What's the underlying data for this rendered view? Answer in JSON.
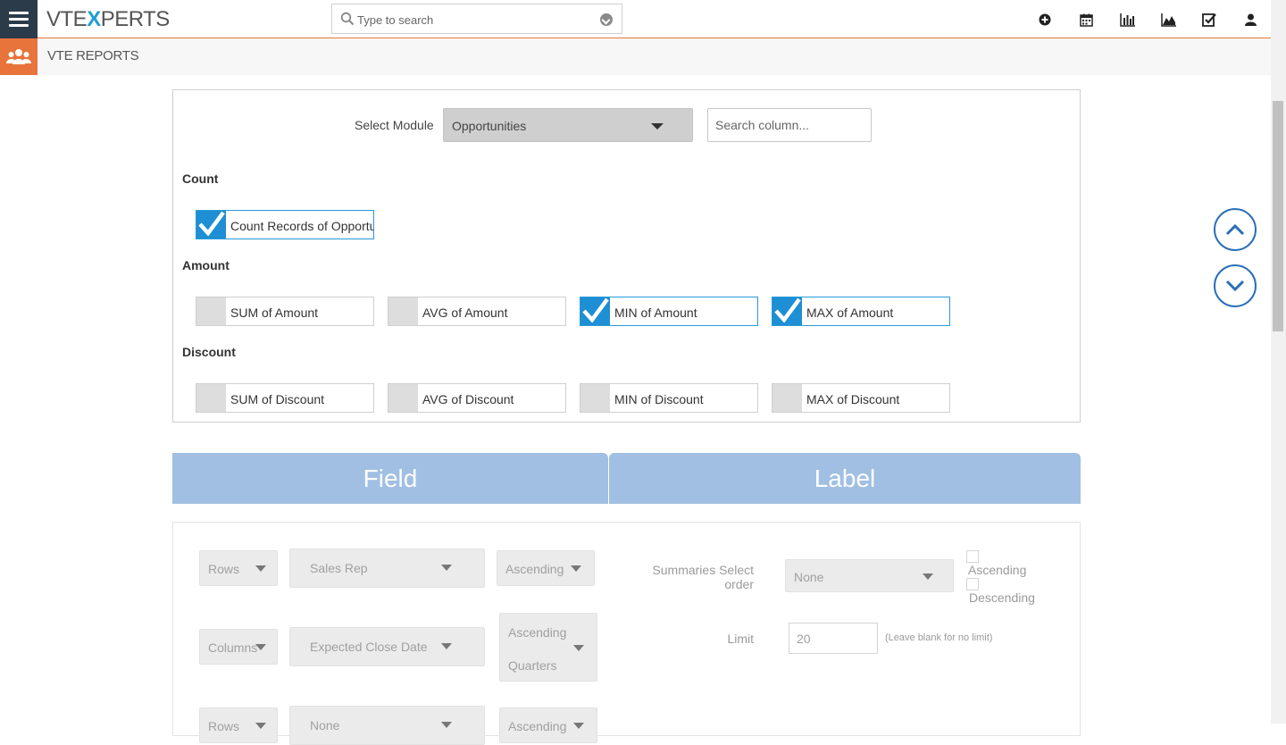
{
  "navbar": {
    "logo_pre": "VTE",
    "logo_x": "X",
    "logo_post": "PERTS",
    "search_placeholder": "Type to search",
    "icons": [
      "plus-circle-icon",
      "calendar-icon",
      "bar-chart-icon",
      "area-chart-icon",
      "checkbox-icon",
      "user-icon"
    ]
  },
  "module": {
    "title": "VTE REPORTS",
    "icon": "users-icon",
    "accent": "#e8743b"
  },
  "selector": {
    "label": "Select Module",
    "module_value": "Opportunities",
    "column_search_placeholder": "Search column..."
  },
  "groups": {
    "count": {
      "title": "Count",
      "items": [
        {
          "label": "Count Records of Opportunities",
          "checked": true
        }
      ]
    },
    "amount": {
      "title": "Amount",
      "items": [
        {
          "label": "SUM of Amount",
          "checked": false
        },
        {
          "label": "AVG of Amount",
          "checked": false
        },
        {
          "label": "MIN of Amount",
          "checked": true
        },
        {
          "label": "MAX of Amount",
          "checked": true
        }
      ]
    },
    "discount": {
      "title": "Discount",
      "items": [
        {
          "label": "SUM of Discount",
          "checked": false
        },
        {
          "label": "AVG of Discount",
          "checked": false
        },
        {
          "label": "MIN of Discount",
          "checked": false
        },
        {
          "label": "MAX of Discount",
          "checked": false
        }
      ]
    }
  },
  "table_header": {
    "field": "Field",
    "label": "Label"
  },
  "config": {
    "row1": {
      "type": "Rows",
      "field": "Sales Rep",
      "order": "Ascending"
    },
    "row2": {
      "type": "Columns",
      "field": "Expected Close Date",
      "order": "Ascending",
      "interval": "Quarters"
    },
    "row3": {
      "type": "Rows",
      "field": "None",
      "order": "Ascending"
    },
    "summaries": {
      "label": "Summaries Select order",
      "value": "None",
      "asc_label": "Ascending",
      "desc_label": "Descending"
    },
    "limit": {
      "label": "Limit",
      "value": "20",
      "hint": "(Leave blank for no limit)"
    }
  },
  "colors": {
    "checked": "#1e8fd4",
    "header_blue": "#a0bfe3",
    "nav_dark": "#2c3b49"
  }
}
